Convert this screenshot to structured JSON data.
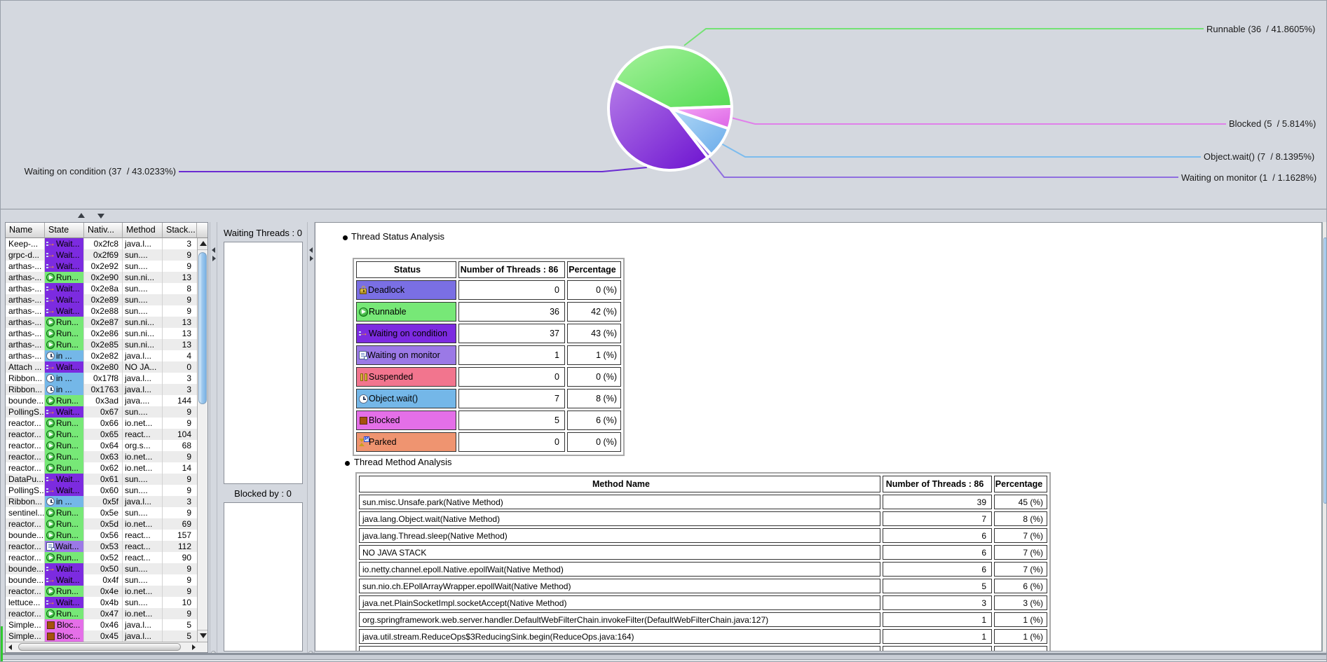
{
  "chart_data": {
    "type": "pie",
    "title": "",
    "total_threads": 86,
    "legend_position": "outside-leader-lines",
    "slices": [
      {
        "label": "Runnable",
        "value": 36,
        "pct": 41.8605,
        "display": "Runnable (36  / 41.8605%)",
        "grad": [
          "#a6f29c",
          "#54dc54"
        ],
        "line": "#74e274"
      },
      {
        "label": "Waiting on condition",
        "value": 37,
        "pct": 43.0233,
        "display": "Waiting on condition (37  / 43.0233%)",
        "grad": [
          "#b47ae8",
          "#6d13d0"
        ],
        "line": "#6a2ad2"
      },
      {
        "label": "Waiting on monitor",
        "value": 1,
        "pct": 1.1628,
        "display": "Waiting on monitor (1  / 1.1628%)",
        "grad": [
          "#9a78e6",
          "#8a5fe0"
        ],
        "line": "#8f6ee0"
      },
      {
        "label": "Object.wait()",
        "value": 7,
        "pct": 8.1395,
        "display": "Object.wait() (7  / 8.1395%)",
        "grad": [
          "#b2d9f6",
          "#6aabea"
        ],
        "line": "#7cbcee"
      },
      {
        "label": "Blocked",
        "value": 5,
        "pct": 5.814,
        "display": "Blocked (5  / 5.814%)",
        "grad": [
          "#f4a4f4",
          "#dc64e6"
        ],
        "line": "#e080ea"
      }
    ]
  },
  "thread_table": {
    "headers": [
      "Name",
      "State",
      "Nativ...",
      "Method",
      "Stack..."
    ],
    "state_styles": {
      "wait": {
        "color": "#7c2be0",
        "label": "Wait...",
        "icon": "waiting-arrow-icon"
      },
      "run": {
        "color": "#77e877",
        "label": "Run...",
        "icon": "play-icon"
      },
      "owait": {
        "color": "#74b7e8",
        "label": "in ...",
        "icon": "clock-icon"
      },
      "block": {
        "color": "#e46fe8",
        "label": "Bloc...",
        "icon": "blocked-icon"
      },
      "mon": {
        "color": "#9b79e6",
        "label": "Wait...",
        "icon": "monitor-wait-icon"
      }
    },
    "rows": [
      {
        "name": "Keep-...",
        "state": "wait",
        "native": "0x2fc8",
        "method": "java.l...",
        "stack": "3"
      },
      {
        "name": "grpc-d...",
        "state": "wait",
        "native": "0x2f69",
        "method": "sun....",
        "stack": "9"
      },
      {
        "name": "arthas-...",
        "state": "wait",
        "native": "0x2e92",
        "method": "sun....",
        "stack": "9"
      },
      {
        "name": "arthas-...",
        "state": "run",
        "native": "0x2e90",
        "method": "sun.ni...",
        "stack": "13"
      },
      {
        "name": "arthas-...",
        "state": "wait",
        "native": "0x2e8a",
        "method": "sun....",
        "stack": "8"
      },
      {
        "name": "arthas-...",
        "state": "wait",
        "native": "0x2e89",
        "method": "sun....",
        "stack": "9"
      },
      {
        "name": "arthas-...",
        "state": "wait",
        "native": "0x2e88",
        "method": "sun....",
        "stack": "9"
      },
      {
        "name": "arthas-...",
        "state": "run",
        "native": "0x2e87",
        "method": "sun.ni...",
        "stack": "13"
      },
      {
        "name": "arthas-...",
        "state": "run",
        "native": "0x2e86",
        "method": "sun.ni...",
        "stack": "13"
      },
      {
        "name": "arthas-...",
        "state": "run",
        "native": "0x2e85",
        "method": "sun.ni...",
        "stack": "13"
      },
      {
        "name": "arthas-...",
        "state": "owait",
        "native": "0x2e82",
        "method": "java.l...",
        "stack": "4"
      },
      {
        "name": "Attach ...",
        "state": "wait",
        "native": "0x2e80",
        "method": "NO JA...",
        "stack": "0"
      },
      {
        "name": "Ribbon...",
        "state": "owait",
        "native": "0x17f8",
        "method": "java.l...",
        "stack": "3"
      },
      {
        "name": "Ribbon...",
        "state": "owait",
        "native": "0x1763",
        "method": "java.l...",
        "stack": "3"
      },
      {
        "name": "bounde...",
        "state": "run",
        "native": "0x3ad",
        "method": "java....",
        "stack": "144"
      },
      {
        "name": "PollingS...",
        "state": "wait",
        "native": "0x67",
        "method": "sun....",
        "stack": "9"
      },
      {
        "name": "reactor...",
        "state": "run",
        "native": "0x66",
        "method": "io.net...",
        "stack": "9"
      },
      {
        "name": "reactor...",
        "state": "run",
        "native": "0x65",
        "method": "react...",
        "stack": "104"
      },
      {
        "name": "reactor...",
        "state": "run",
        "native": "0x64",
        "method": "org.s...",
        "stack": "68"
      },
      {
        "name": "reactor...",
        "state": "run",
        "native": "0x63",
        "method": "io.net...",
        "stack": "9"
      },
      {
        "name": "reactor...",
        "state": "run",
        "native": "0x62",
        "method": "io.net...",
        "stack": "14"
      },
      {
        "name": "DataPu...",
        "state": "wait",
        "native": "0x61",
        "method": "sun....",
        "stack": "9"
      },
      {
        "name": "PollingS...",
        "state": "wait",
        "native": "0x60",
        "method": "sun....",
        "stack": "9"
      },
      {
        "name": "Ribbon...",
        "state": "owait",
        "native": "0x5f",
        "method": "java.l...",
        "stack": "3"
      },
      {
        "name": "sentinel...",
        "state": "run",
        "native": "0x5e",
        "method": "sun....",
        "stack": "9"
      },
      {
        "name": "reactor...",
        "state": "run",
        "native": "0x5d",
        "method": "io.net...",
        "stack": "69"
      },
      {
        "name": "bounde...",
        "state": "run",
        "native": "0x56",
        "method": "react...",
        "stack": "157"
      },
      {
        "name": "reactor...",
        "state": "mon",
        "native": "0x53",
        "method": "react...",
        "stack": "112"
      },
      {
        "name": "reactor...",
        "state": "run",
        "native": "0x52",
        "method": "react...",
        "stack": "90"
      },
      {
        "name": "bounde...",
        "state": "wait",
        "native": "0x50",
        "method": "sun....",
        "stack": "9"
      },
      {
        "name": "bounde...",
        "state": "wait",
        "native": "0x4f",
        "method": "sun....",
        "stack": "9"
      },
      {
        "name": "reactor...",
        "state": "run",
        "native": "0x4e",
        "method": "io.net...",
        "stack": "9"
      },
      {
        "name": "lettuce...",
        "state": "wait",
        "native": "0x4b",
        "method": "sun....",
        "stack": "10"
      },
      {
        "name": "reactor...",
        "state": "run",
        "native": "0x47",
        "method": "io.net...",
        "stack": "9"
      },
      {
        "name": "Simple...",
        "state": "block",
        "native": "0x46",
        "method": "java.l...",
        "stack": "5"
      },
      {
        "name": "Simple...",
        "state": "block",
        "native": "0x45",
        "method": "java.l...",
        "stack": "5"
      }
    ]
  },
  "waiting_panel": {
    "waiting_label": "Waiting Threads : 0",
    "blocked_label": "Blocked by : 0"
  },
  "status_analysis": {
    "title": "Thread Status Analysis",
    "headers": [
      "Status",
      "Number of Threads : 86",
      "Percentage"
    ],
    "rows": [
      {
        "label": "Deadlock",
        "icon": "lock-icon",
        "color": "#7a6fe4",
        "count": "0",
        "pct": "0 (%)"
      },
      {
        "label": "Runnable",
        "icon": "play-icon",
        "color": "#77e877",
        "count": "36",
        "pct": "42 (%)"
      },
      {
        "label": "Waiting on condition",
        "icon": "waiting-arrow-icon",
        "color": "#7c2be0",
        "count": "37",
        "pct": "43 (%)"
      },
      {
        "label": "Waiting on monitor",
        "icon": "monitor-wait-icon",
        "color": "#9b79e6",
        "count": "1",
        "pct": "1 (%)"
      },
      {
        "label": "Suspended",
        "icon": "pause-icon",
        "color": "#f2758e",
        "count": "0",
        "pct": "0 (%)"
      },
      {
        "label": "Object.wait()",
        "icon": "clock-icon",
        "color": "#74b7e8",
        "count": "7",
        "pct": "8 (%)"
      },
      {
        "label": "Blocked",
        "icon": "blocked-icon",
        "color": "#e46fe8",
        "count": "5",
        "pct": "6 (%)"
      },
      {
        "label": "Parked",
        "icon": "parked-icon",
        "color": "#ef9470",
        "count": "0",
        "pct": "0 (%)"
      }
    ]
  },
  "method_analysis": {
    "title": "Thread Method Analysis",
    "headers": [
      "Method Name",
      "Number of Threads : 86",
      "Percentage"
    ],
    "rows": [
      {
        "method": "sun.misc.Unsafe.park(Native Method)",
        "count": "39",
        "pct": "45 (%)"
      },
      {
        "method": "java.lang.Object.wait(Native Method)",
        "count": "7",
        "pct": "8 (%)"
      },
      {
        "method": "java.lang.Thread.sleep(Native Method)",
        "count": "6",
        "pct": "7 (%)"
      },
      {
        "method": "NO JAVA STACK",
        "count": "6",
        "pct": "7 (%)"
      },
      {
        "method": "io.netty.channel.epoll.Native.epollWait(Native Method)",
        "count": "6",
        "pct": "7 (%)"
      },
      {
        "method": "sun.nio.ch.EPollArrayWrapper.epollWait(Native Method)",
        "count": "5",
        "pct": "6 (%)"
      },
      {
        "method": "java.net.PlainSocketImpl.socketAccept(Native Method)",
        "count": "3",
        "pct": "3 (%)"
      },
      {
        "method": "org.springframework.web.server.handler.DefaultWebFilterChain.invokeFilter(DefaultWebFilterChain.java:127)",
        "count": "1",
        "pct": "1 (%)"
      },
      {
        "method": "java.util.stream.ReduceOps$3ReducingSink.begin(ReduceOps.java:164)",
        "count": "1",
        "pct": "1 (%)"
      }
    ]
  }
}
